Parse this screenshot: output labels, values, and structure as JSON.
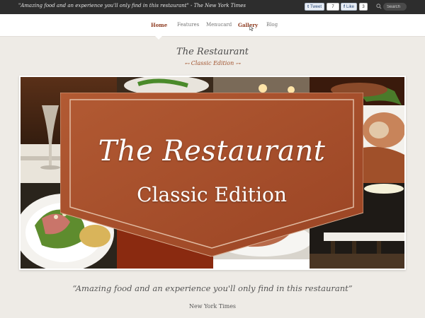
{
  "topbar": {
    "quote": "\"Amazing food and an experience you'll only find in this restaurant\" - The New York Times",
    "tweet": {
      "label": "Tweet",
      "count": "7"
    },
    "like": {
      "label": "Like",
      "count": "3"
    },
    "search": {
      "placeholder": "Search"
    }
  },
  "nav": {
    "items": [
      "Home",
      "Features",
      "Menucard",
      "Gallery",
      "Blog"
    ],
    "active": "Home",
    "accent_color": "#8d3a1f"
  },
  "logo": {
    "title": "The Restaurant",
    "subtitle": "Classic Edition"
  },
  "slider": {
    "banner_title": "The Restaurant",
    "banner_subtitle": "Classic Edition",
    "banner_color": "#a8502c"
  },
  "testimonial": {
    "quote": "“Amazing food and an experience you'll only find in this restaurant”",
    "source": "New York Times"
  }
}
